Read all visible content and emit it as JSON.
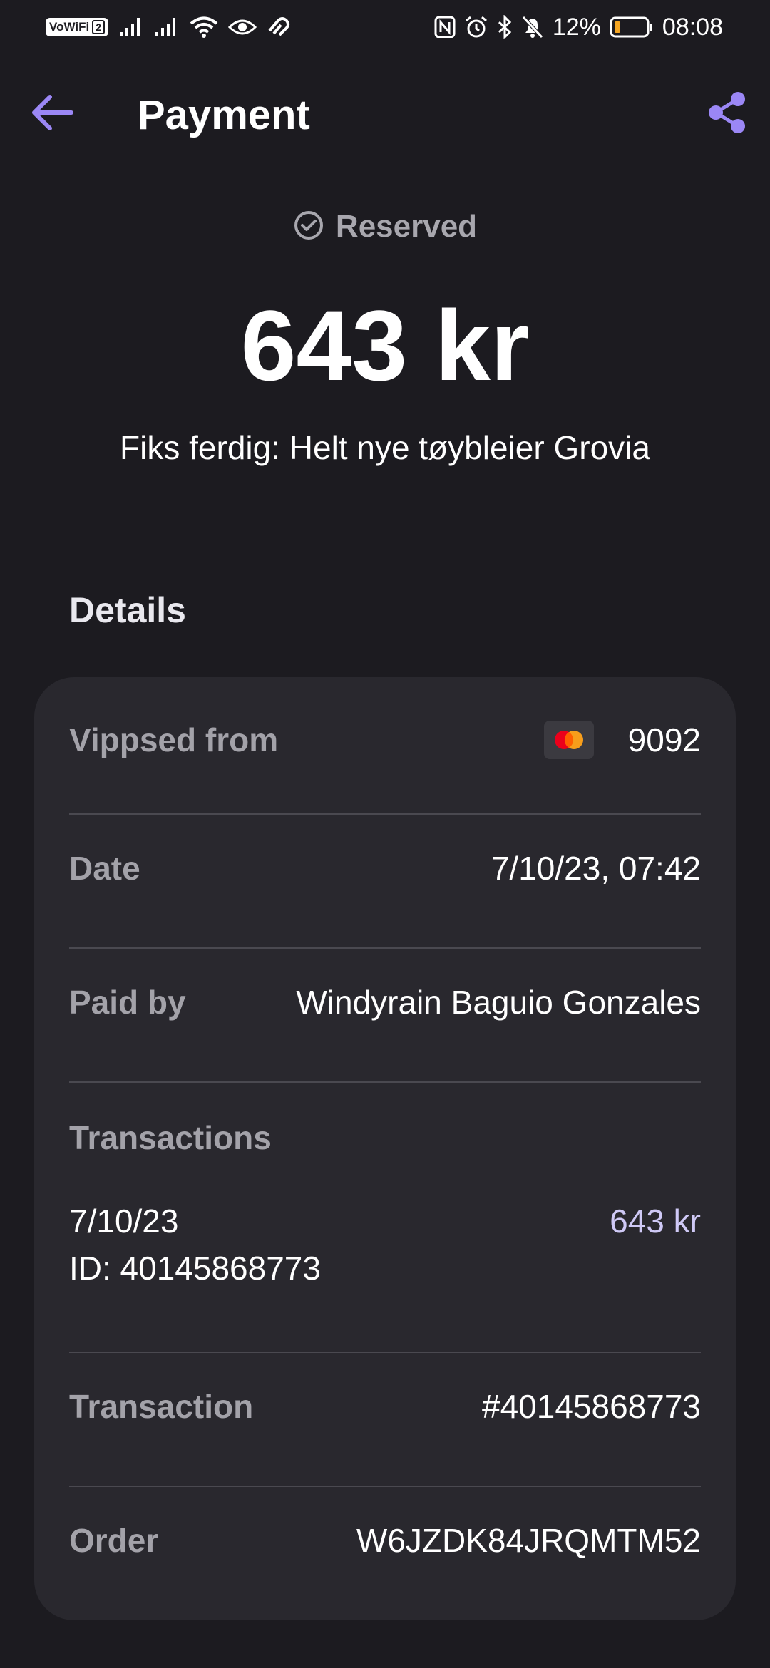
{
  "status_bar": {
    "vowifi": "VoWiFi",
    "sim_slot": "2",
    "battery_percent": "12%",
    "time": "08:08"
  },
  "app_bar": {
    "title": "Payment"
  },
  "payment": {
    "status": "Reserved",
    "amount": "643 kr",
    "description": "Fiks ferdig: Helt nye tøybleier Grovia"
  },
  "details": {
    "title": "Details",
    "vippsed_from_label": "Vippsed from",
    "card_last_digits": "9092",
    "date_label": "Date",
    "date_value": "7/10/23, 07:42",
    "paid_by_label": "Paid by",
    "paid_by_value": "Windyrain Baguio Gonzales",
    "transactions_label": "Transactions",
    "transactions": [
      {
        "date": "7/10/23",
        "id": "ID: 40145868773",
        "amount": "643 kr"
      }
    ],
    "transaction_label": "Transaction",
    "transaction_value": "#40145868773",
    "order_label": "Order",
    "order_value": "W6JZDK84JRQMTM52"
  },
  "colors": {
    "background": "#1c1b20",
    "card": "#29282e",
    "accent": "#9b87f5",
    "mastercard_red": "#eb001b",
    "mastercard_orange": "#f79e1b",
    "battery_low": "#f5a623"
  }
}
